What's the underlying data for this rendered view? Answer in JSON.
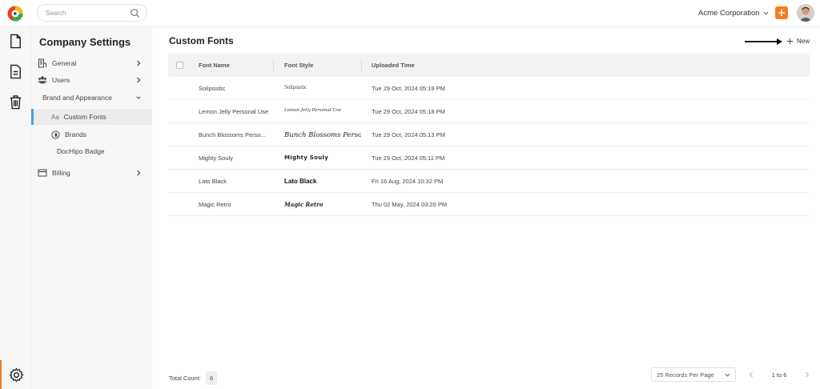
{
  "topbar": {
    "search_placeholder": "Search",
    "org_name": "Acme Corporation"
  },
  "sidebar": {
    "title": "Company Settings",
    "items": [
      {
        "label": "General"
      },
      {
        "label": "Users"
      },
      {
        "label": "Brand and Appearance"
      },
      {
        "label": "Custom Fonts"
      },
      {
        "label": "Brands"
      },
      {
        "label": "DocHipo Badge"
      },
      {
        "label": "Billing"
      }
    ]
  },
  "main": {
    "title": "Custom Fonts",
    "new_label": "New",
    "columns": [
      "Font Name",
      "Font Style",
      "Uploaded Time"
    ],
    "rows": [
      {
        "name": "Solipsistic",
        "style": "Solipsistic",
        "time": "Tue 29 Oct, 2024 05:19 PM"
      },
      {
        "name": "Lemon Jelly Personal Use",
        "style": "Lemon Jelly Personal Use",
        "time": "Tue 29 Oct, 2024 05:18 PM"
      },
      {
        "name": "Bunch Blossoms Perso...",
        "style": "Bunch Blossoms Persona...",
        "time": "Tue 29 Oct, 2024 05:13 PM"
      },
      {
        "name": "Mighty Souly",
        "style": "Mighty Souly",
        "time": "Tue 29 Oct, 2024 05:11 PM"
      },
      {
        "name": "Lato Black",
        "style": "Lato Black",
        "time": "Fri 16 Aug, 2024 10:32 PM"
      },
      {
        "name": "Magic Retro",
        "style": "Magic Retro",
        "time": "Thu 02 May, 2024 03:20 PM"
      }
    ]
  },
  "footer": {
    "total_label": "Total Count:",
    "total_count": "6",
    "per_page": "25 Records Per Page",
    "range": "1 to 6"
  },
  "colors": {
    "accent": "#f57c1f",
    "active_marker": "#4aa3df"
  }
}
